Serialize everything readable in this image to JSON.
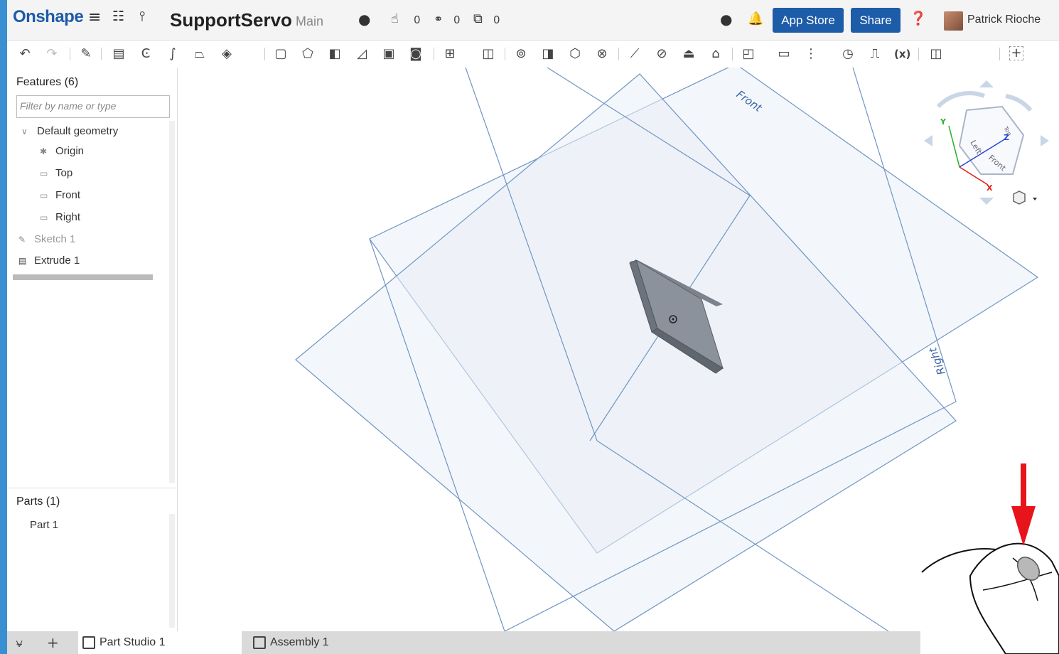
{
  "app": {
    "logo": "Onshape",
    "document_title": "SupportServo",
    "branch": "Main",
    "likes": "0",
    "links": "0",
    "copies": "0",
    "app_store_label": "App Store",
    "share_label": "Share",
    "user_name": "Patrick Rioche"
  },
  "features_panel": {
    "title": "Features (6)",
    "filter_placeholder": "Filter by name or type",
    "default_geometry": "Default geometry",
    "items": [
      "Origin",
      "Top",
      "Front",
      "Right"
    ],
    "sketch": "Sketch 1",
    "extrude": "Extrude 1"
  },
  "parts_panel": {
    "title": "Parts (1)",
    "items": [
      "Part 1"
    ]
  },
  "viewport": {
    "plane_labels": {
      "front": "Front",
      "right": "Right"
    },
    "view_cube": {
      "left": "Left",
      "front": "Front",
      "top": "Top"
    },
    "axes": {
      "x": "X",
      "y": "Y",
      "z": "Z"
    }
  },
  "tabs": [
    "Part Studio 1",
    "Assembly 1"
  ],
  "colors": {
    "brand": "#1e5aa8",
    "button": "#1d5ca8",
    "plane": "#6f95c4",
    "plane_fill": "#e9eef6",
    "arrow": "#e8141b"
  },
  "icons": [
    "hamburger-icon",
    "feature-list-icon",
    "branch-icon",
    "globe-icon",
    "like-icon",
    "link-icon",
    "copy-icon",
    "chat-icon",
    "bell-icon",
    "help-icon",
    "undo-icon",
    "redo-icon"
  ]
}
